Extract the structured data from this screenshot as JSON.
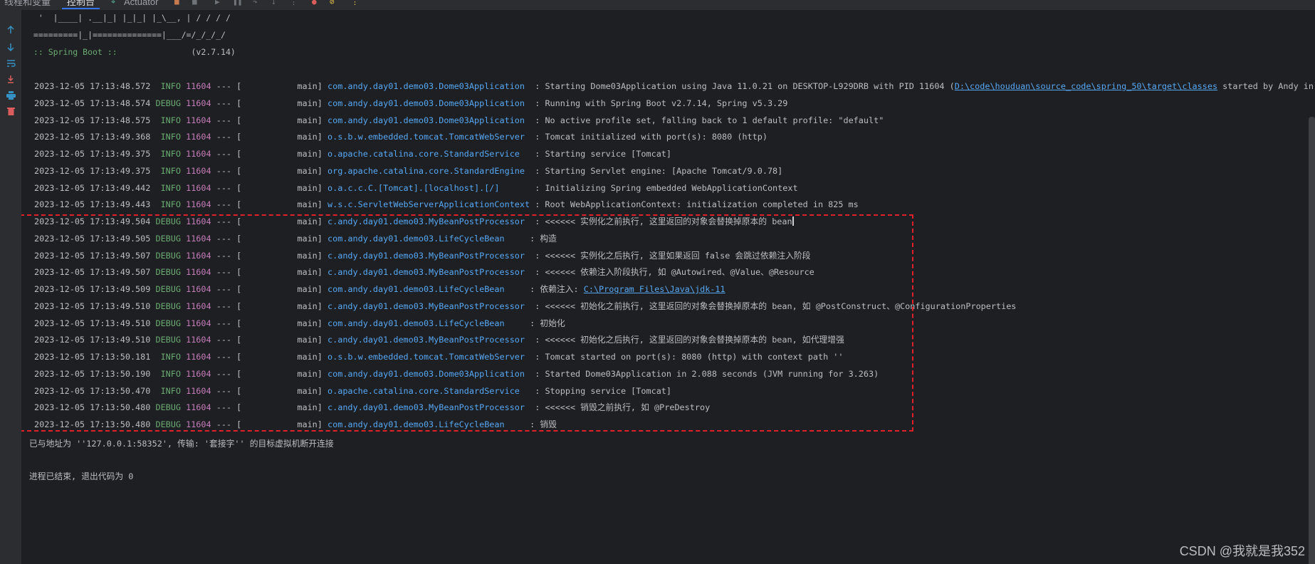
{
  "toolbar": {
    "tabs": [
      "线程和变量",
      "控制台",
      "Actuator"
    ],
    "active_tab": "控制台"
  },
  "banner": {
    "line1": "  '  |____| .__|_| |_|_| |_\\__, | / / / /",
    "line2": " =========|_|==============|___/=/_/_/_/",
    "line3_prefix": " :: Spring Boot :: ",
    "line3_dots": "              ",
    "line3_version": "(v2.7.14)"
  },
  "log_rows": [
    {
      "ts": "2023-12-05 17:13:48.572",
      "level": " INFO",
      "pid": "11604",
      "thread": "main",
      "logger": "com.andy.day01.demo03.Dome03Application",
      "logger_pad": " ",
      "msg": "Starting Dome03Application using Java 11.0.21 on DESKTOP-L929DRB with PID 11604 (",
      "link": "D:\\code\\houduan\\source_code\\spring_50\\target\\classes",
      "msg_after": " started by Andy in D:"
    },
    {
      "ts": "2023-12-05 17:13:48.574",
      "level": "DEBUG",
      "pid": "11604",
      "thread": "main",
      "logger": "com.andy.day01.demo03.Dome03Application",
      "logger_pad": " ",
      "msg": "Running with Spring Boot v2.7.14, Spring v5.3.29"
    },
    {
      "ts": "2023-12-05 17:13:48.575",
      "level": " INFO",
      "pid": "11604",
      "thread": "main",
      "logger": "com.andy.day01.demo03.Dome03Application",
      "logger_pad": " ",
      "msg": "No active profile set, falling back to 1 default profile: \"default\""
    },
    {
      "ts": "2023-12-05 17:13:49.368",
      "level": " INFO",
      "pid": "11604",
      "thread": "main",
      "logger": "o.s.b.w.embedded.tomcat.TomcatWebServer",
      "logger_pad": " ",
      "msg": "Tomcat initialized with port(s): 8080 (http)"
    },
    {
      "ts": "2023-12-05 17:13:49.375",
      "level": " INFO",
      "pid": "11604",
      "thread": "main",
      "logger": "o.apache.catalina.core.StandardService",
      "logger_pad": "  ",
      "msg": "Starting service [Tomcat]"
    },
    {
      "ts": "2023-12-05 17:13:49.375",
      "level": " INFO",
      "pid": "11604",
      "thread": "main",
      "logger": "org.apache.catalina.core.StandardEngine",
      "logger_pad": " ",
      "msg": "Starting Servlet engine: [Apache Tomcat/9.0.78]"
    },
    {
      "ts": "2023-12-05 17:13:49.442",
      "level": " INFO",
      "pid": "11604",
      "thread": "main",
      "logger": "o.a.c.c.C.[Tomcat].[localhost].[/]",
      "logger_pad": "      ",
      "msg": "Initializing Spring embedded WebApplicationContext"
    },
    {
      "ts": "2023-12-05 17:13:49.443",
      "level": " INFO",
      "pid": "11604",
      "thread": "main",
      "logger": "w.s.c.ServletWebServerApplicationContext",
      "logger_pad": "",
      "msg": "Root WebApplicationContext: initialization completed in 825 ms"
    },
    {
      "ts": "2023-12-05 17:13:49.504",
      "level": "DEBUG",
      "pid": "11604",
      "thread": "main",
      "logger": "c.andy.day01.demo03.MyBeanPostProcessor",
      "logger_pad": " ",
      "msg": "<<<<<< 实例化之前执行, 这里返回的对象会替换掉原本的 bean",
      "cursor": true
    },
    {
      "ts": "2023-12-05 17:13:49.505",
      "level": "DEBUG",
      "pid": "11604",
      "thread": "main",
      "logger": "com.andy.day01.demo03.LifeCycleBean",
      "logger_pad": "    ",
      "msg": "构造"
    },
    {
      "ts": "2023-12-05 17:13:49.507",
      "level": "DEBUG",
      "pid": "11604",
      "thread": "main",
      "logger": "c.andy.day01.demo03.MyBeanPostProcessor",
      "logger_pad": " ",
      "msg": "<<<<<< 实例化之后执行, 这里如果返回 false 会跳过依赖注入阶段"
    },
    {
      "ts": "2023-12-05 17:13:49.507",
      "level": "DEBUG",
      "pid": "11604",
      "thread": "main",
      "logger": "c.andy.day01.demo03.MyBeanPostProcessor",
      "logger_pad": " ",
      "msg": "<<<<<< 依赖注入阶段执行, 如 @Autowired、@Value、@Resource"
    },
    {
      "ts": "2023-12-05 17:13:49.509",
      "level": "DEBUG",
      "pid": "11604",
      "thread": "main",
      "logger": "com.andy.day01.demo03.LifeCycleBean",
      "logger_pad": "    ",
      "msg": "依赖注入: ",
      "link": "C:\\Program Files\\Java\\jdk-11"
    },
    {
      "ts": "2023-12-05 17:13:49.510",
      "level": "DEBUG",
      "pid": "11604",
      "thread": "main",
      "logger": "c.andy.day01.demo03.MyBeanPostProcessor",
      "logger_pad": " ",
      "msg": "<<<<<< 初始化之前执行, 这里返回的对象会替换掉原本的 bean, 如 @PostConstruct、@ConfigurationProperties"
    },
    {
      "ts": "2023-12-05 17:13:49.510",
      "level": "DEBUG",
      "pid": "11604",
      "thread": "main",
      "logger": "com.andy.day01.demo03.LifeCycleBean",
      "logger_pad": "    ",
      "msg": "初始化"
    },
    {
      "ts": "2023-12-05 17:13:49.510",
      "level": "DEBUG",
      "pid": "11604",
      "thread": "main",
      "logger": "c.andy.day01.demo03.MyBeanPostProcessor",
      "logger_pad": " ",
      "msg": "<<<<<< 初始化之后执行, 这里返回的对象会替换掉原本的 bean, 如代理增强"
    },
    {
      "ts": "2023-12-05 17:13:50.181",
      "level": " INFO",
      "pid": "11604",
      "thread": "main",
      "logger": "o.s.b.w.embedded.tomcat.TomcatWebServer",
      "logger_pad": " ",
      "msg": "Tomcat started on port(s): 8080 (http) with context path ''"
    },
    {
      "ts": "2023-12-05 17:13:50.190",
      "level": " INFO",
      "pid": "11604",
      "thread": "main",
      "logger": "com.andy.day01.demo03.Dome03Application",
      "logger_pad": " ",
      "msg": "Started Dome03Application in 2.088 seconds (JVM running for 3.263)"
    },
    {
      "ts": "2023-12-05 17:13:50.470",
      "level": " INFO",
      "pid": "11604",
      "thread": "main",
      "logger": "o.apache.catalina.core.StandardService",
      "logger_pad": "  ",
      "msg": "Stopping service [Tomcat]"
    },
    {
      "ts": "2023-12-05 17:13:50.480",
      "level": "DEBUG",
      "pid": "11604",
      "thread": "main",
      "logger": "c.andy.day01.demo03.MyBeanPostProcessor",
      "logger_pad": " ",
      "msg": "<<<<<< 销毁之前执行, 如 @PreDestroy"
    },
    {
      "ts": "2023-12-05 17:13:50.480",
      "level": "DEBUG",
      "pid": "11604",
      "thread": "main",
      "logger": "com.andy.day01.demo03.LifeCycleBean",
      "logger_pad": "    ",
      "msg": "销毁"
    }
  ],
  "disconnect_msg": "已与地址为 ''127.0.0.1:58352', 传输: '套接字'' 的目标虚拟机断开连接",
  "exit_msg": "进程已结束, 退出代码为 0",
  "watermark": "CSDN @我就是我352",
  "colors": {
    "highlight_box": "#e0202a",
    "logger": "#56a8f5",
    "pid": "#c77dbb",
    "level": "#6aab73"
  }
}
